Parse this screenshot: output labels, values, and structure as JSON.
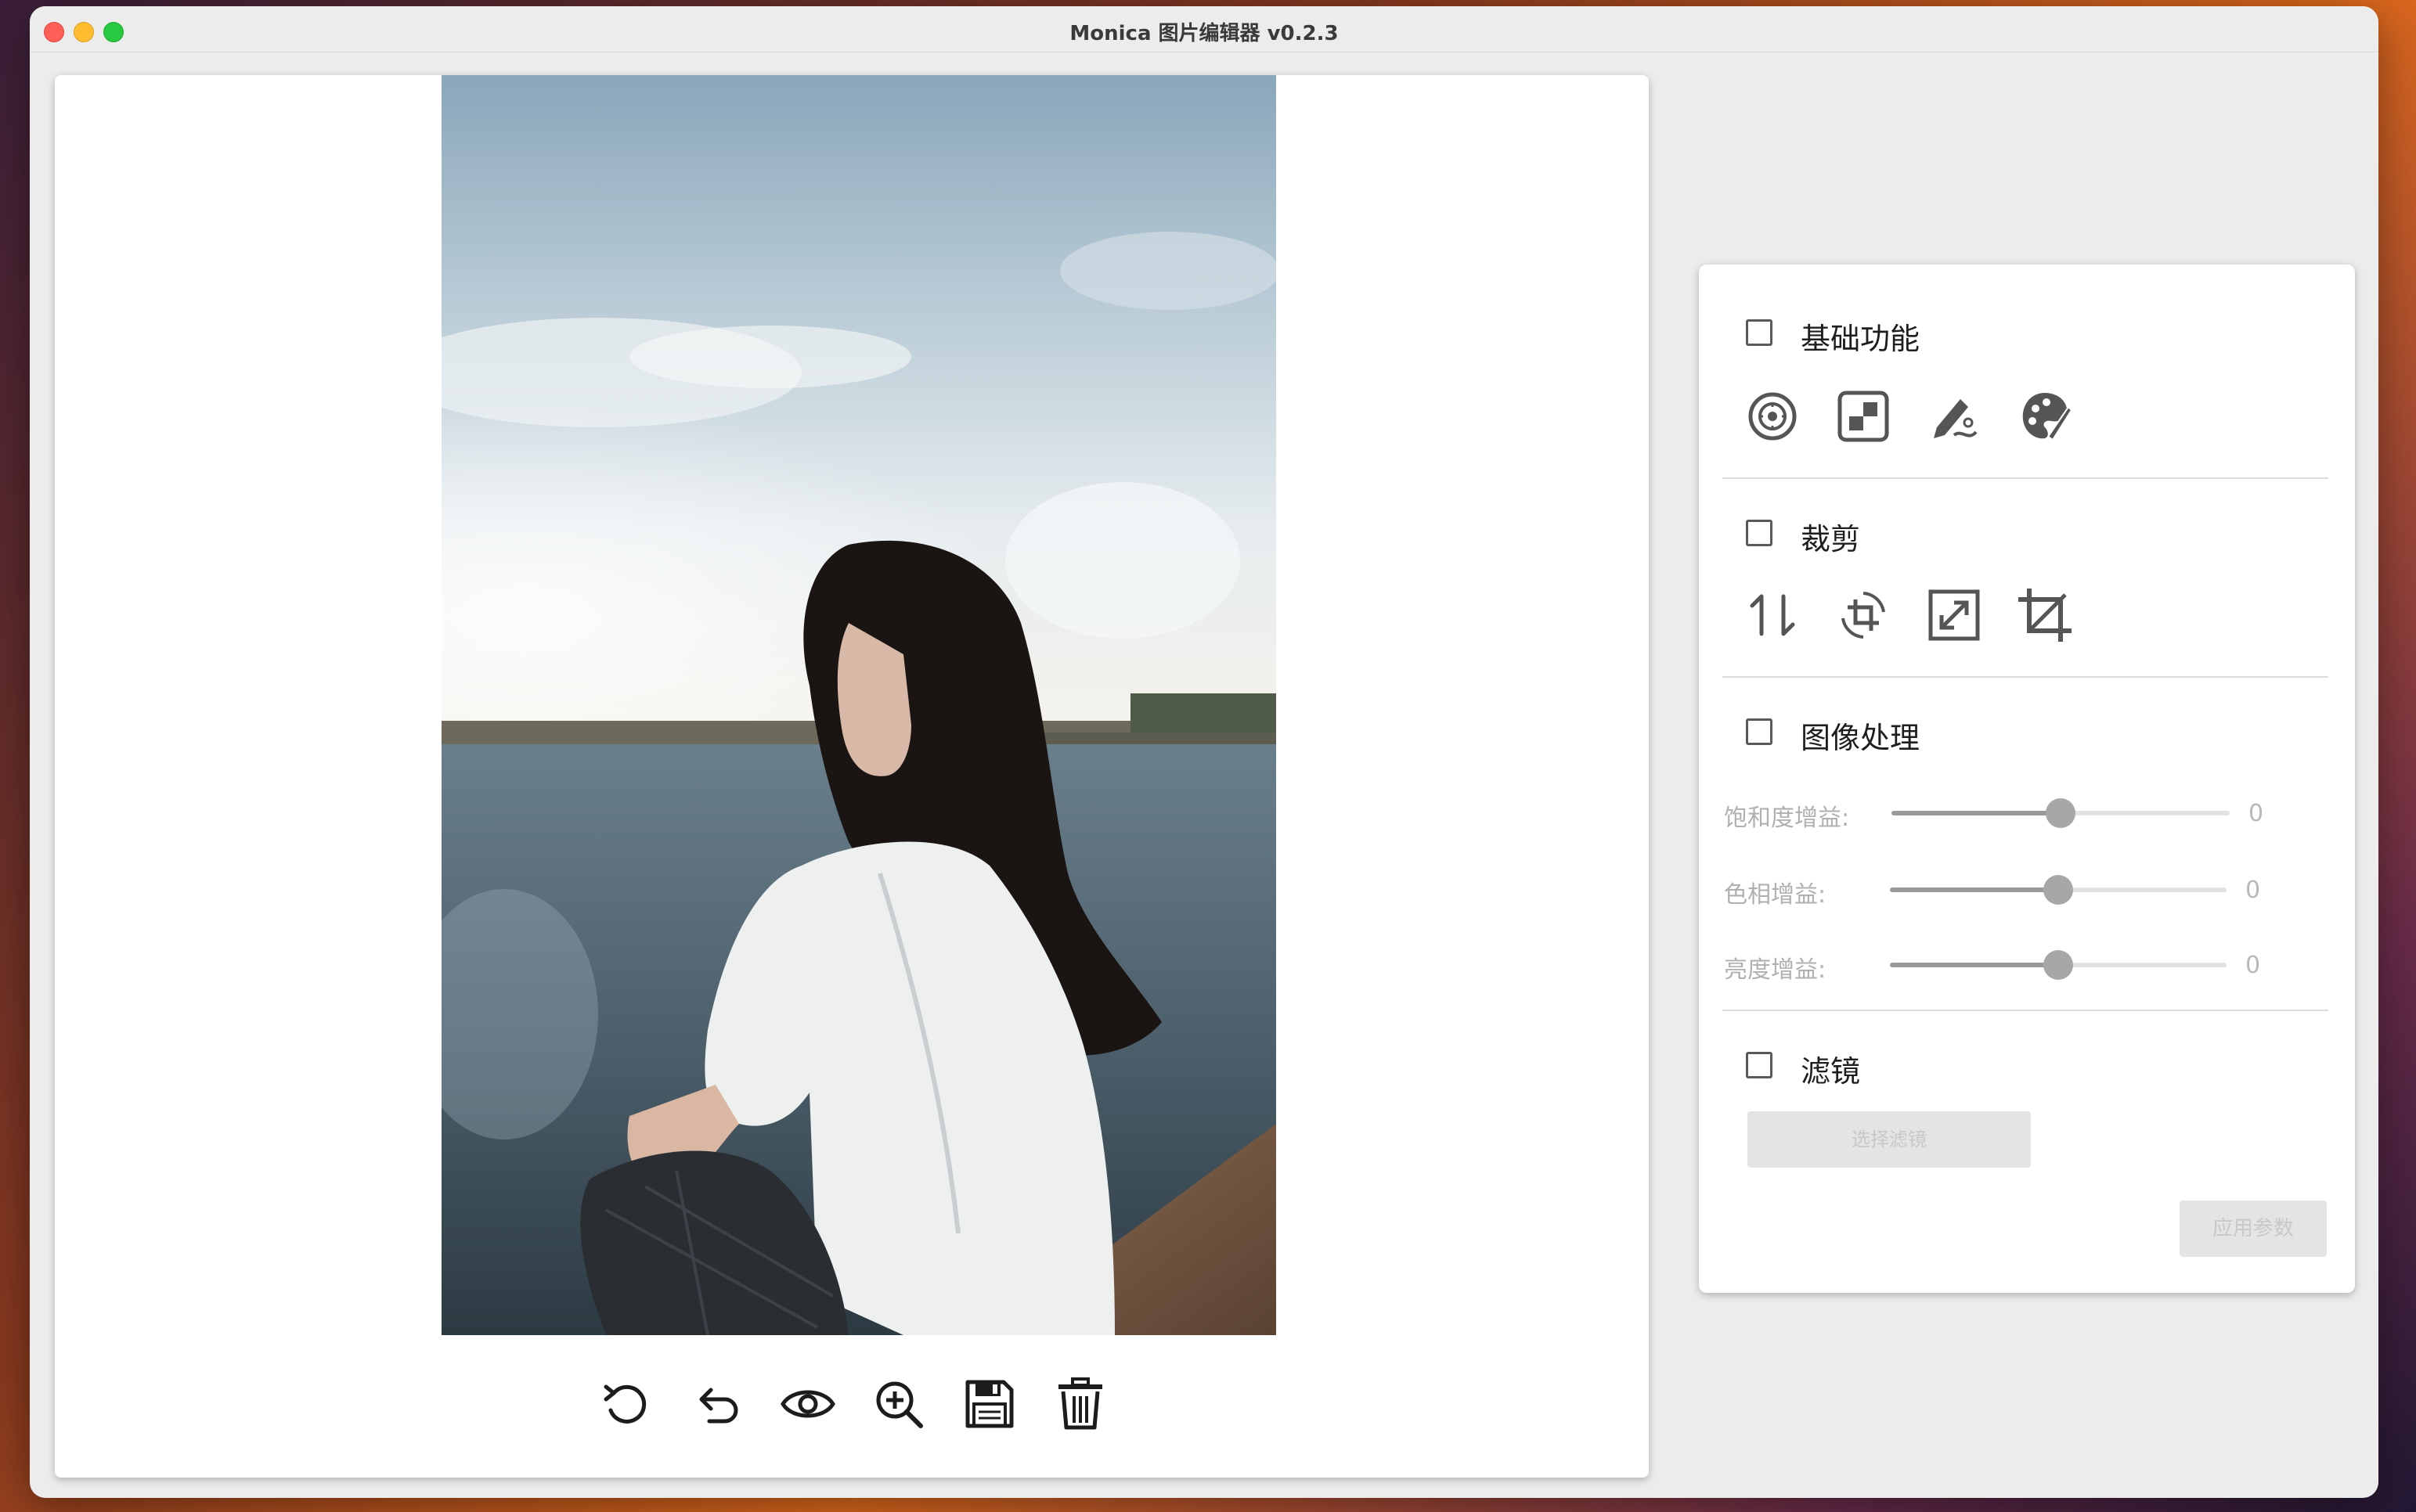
{
  "window": {
    "title": "Monica 图片编辑器 v0.2.3"
  },
  "toolbar": {
    "icons": [
      "rotate-icon",
      "undo-icon",
      "preview-eye-icon",
      "zoom-in-icon",
      "save-icon",
      "delete-icon"
    ]
  },
  "sections": {
    "basic": {
      "label": "基础功能",
      "checked": false,
      "icons": [
        "blur-circle-icon",
        "mosaic-icon",
        "draw-pen-icon",
        "palette-icon"
      ]
    },
    "crop": {
      "label": "裁剪",
      "checked": false,
      "icons": [
        "flip-icon",
        "rotate-crop-icon",
        "resize-icon",
        "crop-icon"
      ]
    },
    "processing": {
      "label": "图像处理",
      "checked": false,
      "sliders": [
        {
          "label": "饱和度增益:",
          "value": "0",
          "level": 0.5
        },
        {
          "label": "色相增益:",
          "value": "0",
          "level": 0.5
        },
        {
          "label": "亮度增益:",
          "value": "0",
          "level": 0.5
        }
      ]
    },
    "filter": {
      "label": "滤镜",
      "checked": false,
      "button": "选择滤镜"
    }
  },
  "apply_button": "应用参数",
  "colors": {
    "accent": "#5a5a5a",
    "disabled": "#e4e4e4"
  }
}
